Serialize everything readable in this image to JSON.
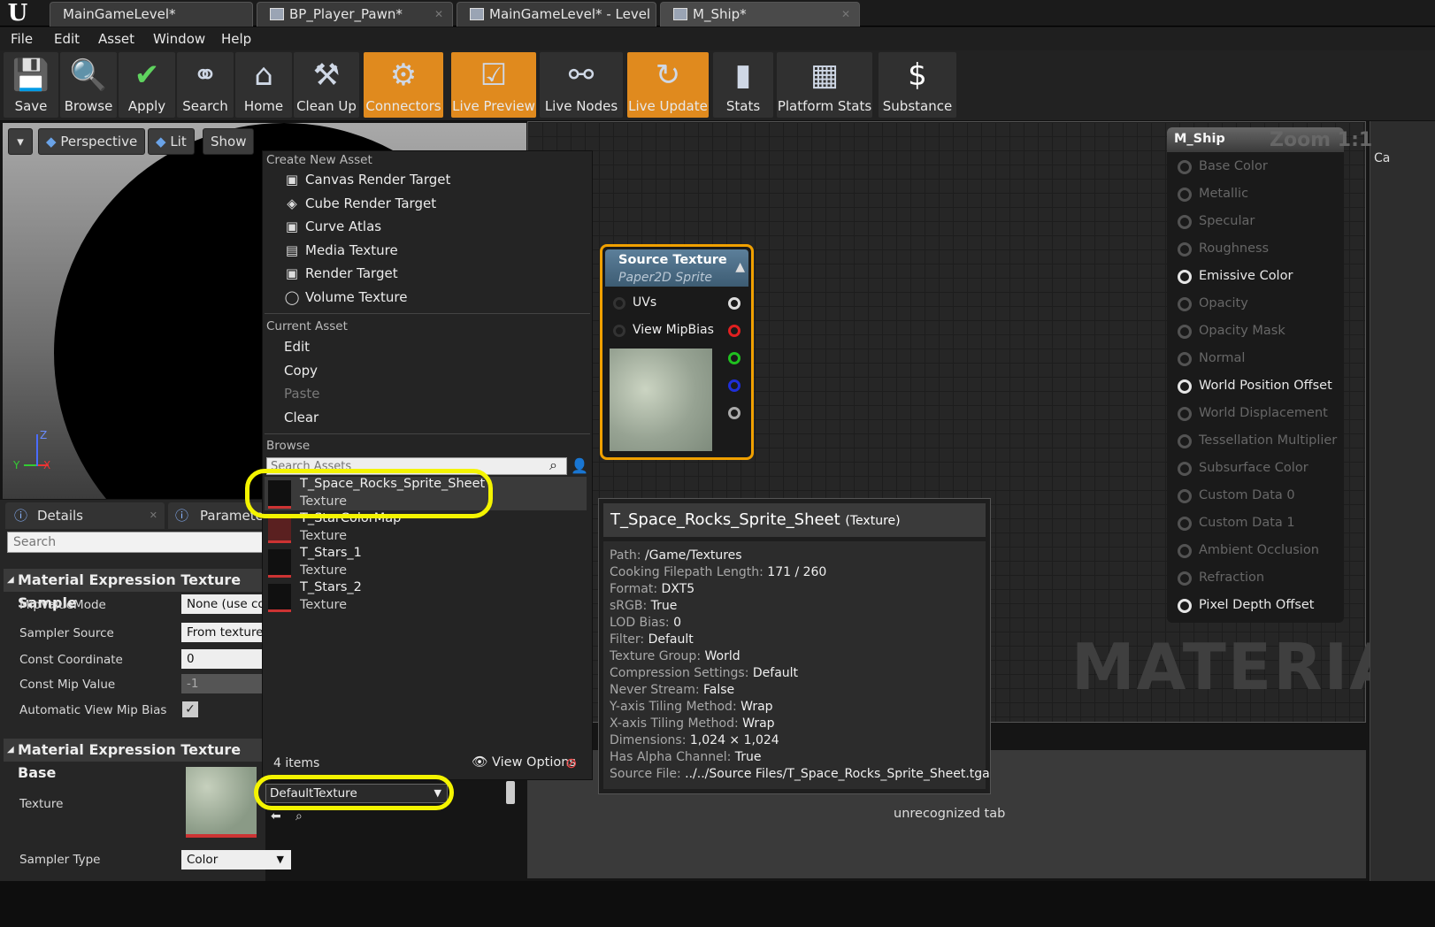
{
  "tabs": [
    {
      "label": "MainGameLevel*"
    },
    {
      "label": "BP_Player_Pawn*"
    },
    {
      "label": "MainGameLevel* - Level"
    },
    {
      "label": "M_Ship*"
    }
  ],
  "menu": [
    "File",
    "Edit",
    "Asset",
    "Window",
    "Help"
  ],
  "toolbar": [
    {
      "label": "Save",
      "icon": "save-icon"
    },
    {
      "label": "Browse",
      "icon": "browse-icon"
    },
    {
      "label": "Apply",
      "icon": "checkmark-icon"
    },
    {
      "label": "Search",
      "icon": "binoculars-icon"
    },
    {
      "label": "Home",
      "icon": "home-icon"
    },
    {
      "label": "Clean Up",
      "icon": "broom-icon"
    },
    {
      "label": "Connectors",
      "icon": "connectors-icon",
      "active": true
    },
    {
      "label": "Live Preview",
      "icon": "preview-icon",
      "active": true
    },
    {
      "label": "Live Nodes",
      "icon": "nodes-icon"
    },
    {
      "label": "Live Update",
      "icon": "update-icon",
      "active": true
    },
    {
      "label": "Stats",
      "icon": "stats-icon"
    },
    {
      "label": "Platform Stats",
      "icon": "platform-icon"
    },
    {
      "label": "Substance",
      "icon": "substance-icon"
    }
  ],
  "viewport": {
    "perspective": "Perspective",
    "lit": "Lit",
    "show": "Show",
    "axis_z": "Z",
    "axis_y": "Y",
    "axis_x": "X"
  },
  "details": {
    "tab_details": "Details",
    "tab_parameters": "Parameters",
    "search_placeholder": "Search",
    "section1": "Material Expression Texture Sample",
    "mip_value_mode_label": "MipValueMode",
    "mip_value_mode_value": "None (use computed",
    "sampler_source_label": "Sampler Source",
    "sampler_source_value": "From texture asset",
    "const_coordinate_label": "Const Coordinate",
    "const_coordinate_value": "0",
    "const_mip_value_label": "Const Mip Value",
    "const_mip_value_value": "-1",
    "auto_view_mip_bias_label": "Automatic View Mip Bias",
    "section2": "Material Expression Texture Base",
    "texture_label": "Texture",
    "texture_value": "DefaultTexture",
    "sampler_type_label": "Sampler Type",
    "sampler_type_value": "Color"
  },
  "dropdown": {
    "create_header": "Create New Asset",
    "create_items": [
      "Canvas Render Target",
      "Cube Render Target",
      "Curve Atlas",
      "Media Texture",
      "Render Target",
      "Volume Texture"
    ],
    "current_header": "Current Asset",
    "current_items": [
      "Edit",
      "Copy",
      "Paste",
      "Clear"
    ],
    "browse_header": "Browse",
    "search_placeholder": "Search Assets",
    "assets": [
      {
        "name": "T_Space_Rocks_Sprite_Sheet",
        "type": "Texture"
      },
      {
        "name": "T_StarColorMap",
        "type": "Texture"
      },
      {
        "name": "T_Stars_1",
        "type": "Texture"
      },
      {
        "name": "T_Stars_2",
        "type": "Texture"
      }
    ],
    "count": "4 items",
    "view_options": "View Options"
  },
  "texture_node": {
    "title": "Source Texture",
    "subtitle": "Paper2D Sprite",
    "pins": [
      "UVs",
      "View MipBias"
    ]
  },
  "tooltip": {
    "title": "T_Space_Rocks_Sprite_Sheet",
    "title_suffix": "(Texture)",
    "rows": [
      {
        "k": "Path:",
        "v": "/Game/Textures"
      },
      {
        "k": "Cooking Filepath Length:",
        "v": "171 / 260"
      },
      {
        "k": "Format:",
        "v": "DXT5"
      },
      {
        "k": "sRGB:",
        "v": "True"
      },
      {
        "k": "LOD Bias:",
        "v": "0"
      },
      {
        "k": "Filter:",
        "v": "Default"
      },
      {
        "k": "Texture Group:",
        "v": "World"
      },
      {
        "k": "Compression Settings:",
        "v": "Default"
      },
      {
        "k": "Never Stream:",
        "v": "False"
      },
      {
        "k": "Y-axis Tiling Method:",
        "v": "Wrap"
      },
      {
        "k": "X-axis Tiling Method:",
        "v": "Wrap"
      },
      {
        "k": "Dimensions:",
        "v": "1,024 × 1,024"
      },
      {
        "k": "Has Alpha Channel:",
        "v": "True"
      },
      {
        "k": "Source File:",
        "v": "../../Source Files/T_Space_Rocks_Sprite_Sheet.tga"
      }
    ]
  },
  "material_node": {
    "title": "M_Ship",
    "zoom": "Zoom 1:1",
    "inputs": [
      {
        "label": "Base Color",
        "on": false
      },
      {
        "label": "Metallic",
        "on": false
      },
      {
        "label": "Specular",
        "on": false
      },
      {
        "label": "Roughness",
        "on": false
      },
      {
        "label": "Emissive Color",
        "on": true
      },
      {
        "label": "Opacity",
        "on": false
      },
      {
        "label": "Opacity Mask",
        "on": false
      },
      {
        "label": "Normal",
        "on": false
      },
      {
        "label": "World Position Offset",
        "on": true
      },
      {
        "label": "World Displacement",
        "on": false
      },
      {
        "label": "Tessellation Multiplier",
        "on": false
      },
      {
        "label": "Subsurface Color",
        "on": false
      },
      {
        "label": "Custom Data 0",
        "on": false
      },
      {
        "label": "Custom Data 1",
        "on": false
      },
      {
        "label": "Ambient Occlusion",
        "on": false
      },
      {
        "label": "Refraction",
        "on": false
      },
      {
        "label": "Pixel Depth Offset",
        "on": true
      }
    ]
  },
  "graph_watermark": "MATERIAL",
  "unrecognized_tab": "unrecognized tab",
  "right_strip_label": "Ca",
  "colors": {
    "accent": "#e08a1e",
    "highlight_ring": "#f4f400",
    "node_border": "#f0a000"
  }
}
